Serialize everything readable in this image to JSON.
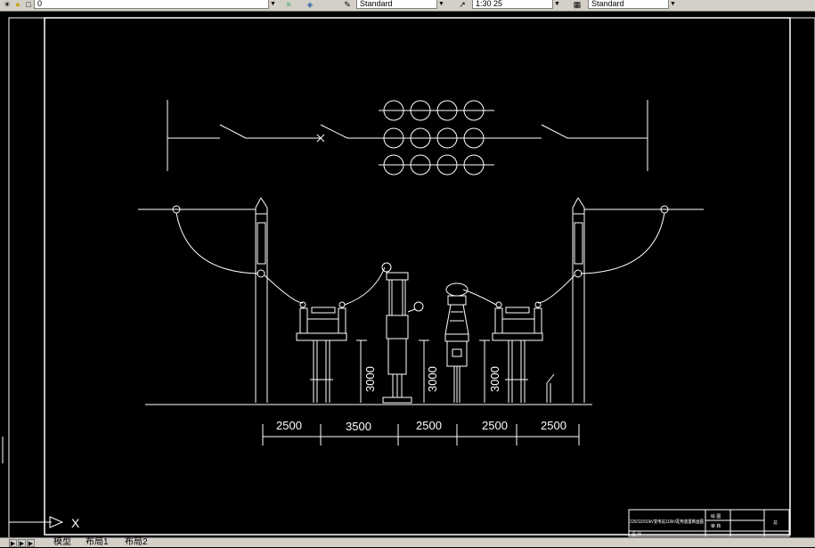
{
  "toolbar": {
    "layer_value": "0",
    "text_style": "Standard",
    "dim_scale": "1:30 25",
    "dim_style": "Standard",
    "icons": [
      "sun-icon",
      "lock-icon",
      "color-square-icon",
      "layer-manager-icon",
      "layers-icon",
      "text-style-icon",
      "dimension-icon",
      "table-style-icon"
    ]
  },
  "drawing": {
    "dimensions": [
      "2500",
      "3500",
      "2500",
      "2500",
      "2500"
    ],
    "heights": [
      "3000",
      "3000",
      "3000"
    ],
    "title_block": {
      "project": "220/110/10kV变电站110kV配电装置断面图",
      "label_drawn": "绘 图",
      "label_check": "审 核",
      "label_design": "设 计",
      "label_total": "总"
    }
  },
  "ucs": {
    "x_label": "X"
  },
  "tabs": [
    {
      "label": "模型"
    },
    {
      "label": "布局1"
    },
    {
      "label": "布局2"
    }
  ],
  "colors": {
    "background": "#000000",
    "lines": "#ffffff",
    "ui": "#d4d0c8"
  }
}
